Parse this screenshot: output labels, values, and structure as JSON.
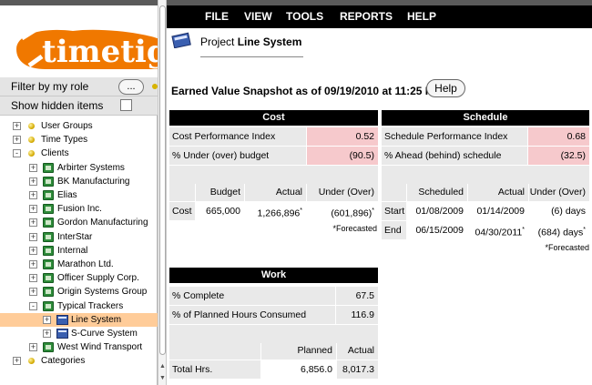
{
  "logo": {
    "text": "timetige"
  },
  "left_panel": {
    "filter_label": "Filter by my role",
    "filter_button": "...",
    "show_hidden_label": "Show hidden items"
  },
  "tree": [
    {
      "label": "User Groups",
      "level": 0,
      "kind": "folder",
      "expander": "+"
    },
    {
      "label": "Time Types",
      "level": 0,
      "kind": "folder",
      "expander": "+"
    },
    {
      "label": "Clients",
      "level": 0,
      "kind": "folder",
      "expander": "-"
    },
    {
      "label": "Arbirter Systems",
      "level": 1,
      "kind": "client",
      "expander": "+"
    },
    {
      "label": "BK Manufacturing",
      "level": 1,
      "kind": "client",
      "expander": "+"
    },
    {
      "label": "Elias",
      "level": 1,
      "kind": "client",
      "expander": "+"
    },
    {
      "label": "Fusion Inc.",
      "level": 1,
      "kind": "client",
      "expander": "+"
    },
    {
      "label": "Gordon Manufacturing",
      "level": 1,
      "kind": "client",
      "expander": "+"
    },
    {
      "label": "InterStar",
      "level": 1,
      "kind": "client",
      "expander": "+"
    },
    {
      "label": "Internal",
      "level": 1,
      "kind": "client",
      "expander": "+"
    },
    {
      "label": "Marathon Ltd.",
      "level": 1,
      "kind": "client",
      "expander": "+"
    },
    {
      "label": "Officer Supply Corp.",
      "level": 1,
      "kind": "client",
      "expander": "+"
    },
    {
      "label": "Origin Systems Group",
      "level": 1,
      "kind": "client",
      "expander": "+"
    },
    {
      "label": "Typical Trackers",
      "level": 1,
      "kind": "client",
      "expander": "-"
    },
    {
      "label": "Line System",
      "level": 2,
      "kind": "project",
      "expander": "+",
      "selected": true
    },
    {
      "label": "S-Curve System",
      "level": 2,
      "kind": "project",
      "expander": "+"
    },
    {
      "label": "West Wind Transport",
      "level": 1,
      "kind": "client",
      "expander": "+"
    },
    {
      "label": "Categories",
      "level": 0,
      "kind": "folder",
      "expander": "+"
    }
  ],
  "menu": [
    "FILE",
    "VIEW",
    "TOOLS",
    "REPORTS",
    "HELP"
  ],
  "project": {
    "prefix": "Project ",
    "name": "Line System"
  },
  "snapshot": {
    "title": "Earned Value Snapshot as of 09/19/2010 at 11:25 PM",
    "help": "Help"
  },
  "cost": {
    "header": "Cost",
    "cpi_label": "Cost Performance Index",
    "cpi_value": "0.52",
    "under_label": "% Under (over) budget",
    "under_value": "(90.5)",
    "col_budget": "Budget",
    "col_actual": "Actual",
    "col_under": "Under (Over)",
    "row_label": "Cost",
    "budget": "665,000",
    "actual": "1,266,896",
    "actual_mark": "*",
    "under": "(601,896)",
    "under_mark": "*",
    "forecast_note": "*Forecasted"
  },
  "schedule": {
    "header": "Schedule",
    "spi_label": "Schedule Performance Index",
    "spi_value": "0.68",
    "ahead_label": "% Ahead (behind) schedule",
    "ahead_value": "(32.5)",
    "col_scheduled": "Scheduled",
    "col_actual": "Actual",
    "col_under": "Under (Over)",
    "start_label": "Start",
    "start_scheduled": "01/08/2009",
    "start_actual": "01/14/2009",
    "start_diff": "(6) days",
    "end_label": "End",
    "end_scheduled": "06/15/2009",
    "end_actual": "04/30/2011",
    "end_actual_mark": "*",
    "end_diff": "(684) days",
    "end_diff_mark": "*",
    "forecast_note": "*Forecasted"
  },
  "work": {
    "header": "Work",
    "complete_label": "% Complete",
    "complete_value": "67.5",
    "consumed_label": "% of Planned Hours Consumed",
    "consumed_value": "116.9",
    "col_planned": "Planned",
    "col_actual": "Actual",
    "total_label": "Total Hrs.",
    "planned": "6,856.0",
    "actual": "8,017.3"
  },
  "colors": {
    "pink": "#f6c9cc",
    "selected": "#ffcc99",
    "header": "#000000",
    "logo_orange": "#f07800"
  }
}
